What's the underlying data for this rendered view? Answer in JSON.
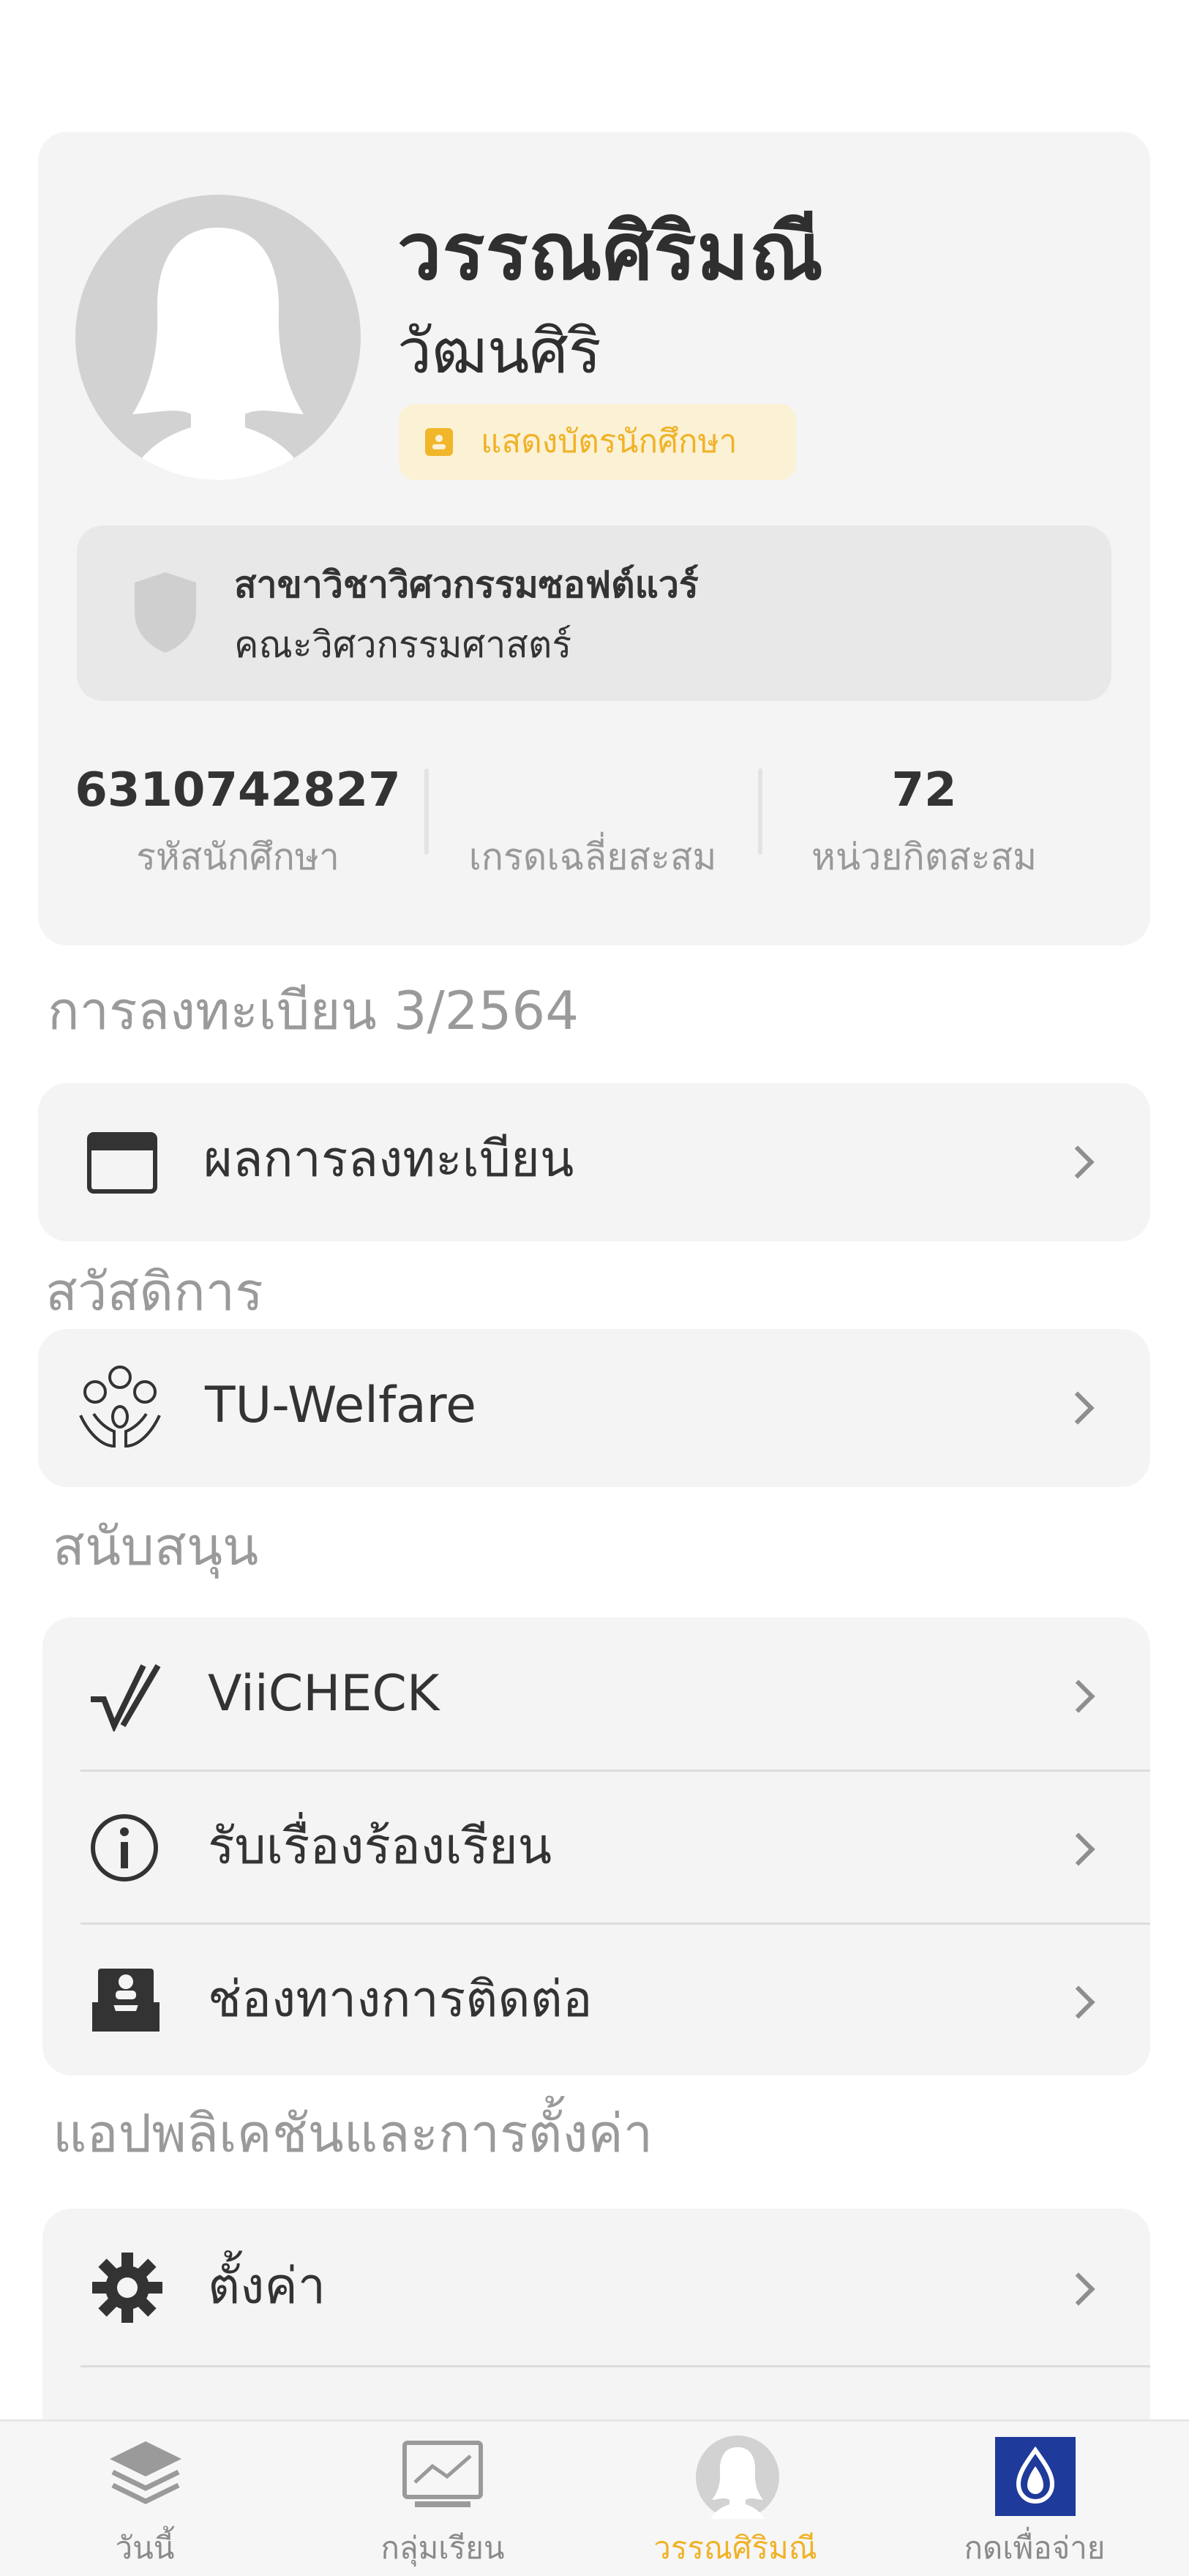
{
  "profile": {
    "first_name": "วรรณศิริมณี",
    "last_name": "วัฒนศิริ",
    "id_card_button": "แสดงบัตรนักศึกษา",
    "department": "สาขาวิชาวิศวกรรมซอฟต์แวร์",
    "faculty": "คณะวิศวกรรมศาสตร์",
    "stats": [
      {
        "value": "6310742827",
        "label": "รหัสนักศึกษา"
      },
      {
        "value": "",
        "label": "เกรดเฉลี่ยสะสม"
      },
      {
        "value": "72",
        "label": "หน่วยกิตสะสม"
      }
    ]
  },
  "sections": {
    "registration": {
      "title": "การลงทะเบียน 3/2564",
      "items": [
        {
          "label": "ผลการลงทะเบียน",
          "icon": "calendar-window-icon"
        }
      ]
    },
    "welfare": {
      "title": "สวัสดิการ",
      "items": [
        {
          "label": "TU-Welfare",
          "icon": "welfare-hands-icon"
        }
      ]
    },
    "support": {
      "title": "สนับสนุน",
      "items": [
        {
          "label": "ViiCHECK",
          "icon": "checkmark-icon"
        },
        {
          "label": "รับเรื่องร้องเรียน",
          "icon": "info-icon"
        },
        {
          "label": "ช่องทางการติดต่อ",
          "icon": "contact-inbox-icon"
        }
      ]
    },
    "settings": {
      "title": "แอปพลิเคชันและการตั้งค่า",
      "items": [
        {
          "label": "ตั้งค่า",
          "icon": "gear-icon"
        }
      ]
    }
  },
  "tabbar": [
    {
      "label": "วันนี้",
      "icon": "layers-icon"
    },
    {
      "label": "กลุ่มเรียน",
      "icon": "chart-board-icon"
    },
    {
      "label": "วรรณศิริมณี",
      "icon": "avatar-icon",
      "active": true
    },
    {
      "label": "กดเพื่อจ่าย",
      "icon": "payment-drop-icon"
    }
  ],
  "colors": {
    "accent": "#f0b227",
    "card_bg": "#f4f4f4",
    "pay_blue": "#1e3a9a"
  }
}
